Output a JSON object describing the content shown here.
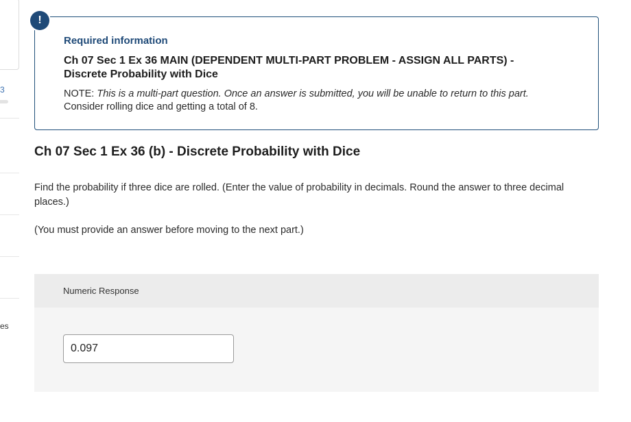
{
  "sidebar": {
    "progress_number": "3",
    "fragment_text": "es"
  },
  "required_info": {
    "badge_symbol": "!",
    "title": "Required information",
    "main_title": "Ch 07 Sec 1 Ex 36 MAIN (DEPENDENT MULTI-PART PROBLEM - ASSIGN ALL PARTS) - Discrete Probability with Dice",
    "note_label": "NOTE:",
    "note_text": "This is a multi-part question. Once an answer is submitted, you will be unable to return to this part.",
    "context": "Consider rolling dice and getting a total of 8."
  },
  "question": {
    "part_title": "Ch 07 Sec 1 Ex 36 (b) - Discrete Probability with Dice",
    "prompt": "Find the probability if three dice are rolled. (Enter the value of probability in decimals. Round the answer to three decimal places.)",
    "instruction": "(You must provide an answer before moving to the next part.)"
  },
  "response": {
    "header": "Numeric Response",
    "value": "0.097"
  },
  "colors": {
    "accent": "#1f4a78",
    "panel_bg": "#f5f5f5",
    "panel_header_bg": "#ececec"
  }
}
